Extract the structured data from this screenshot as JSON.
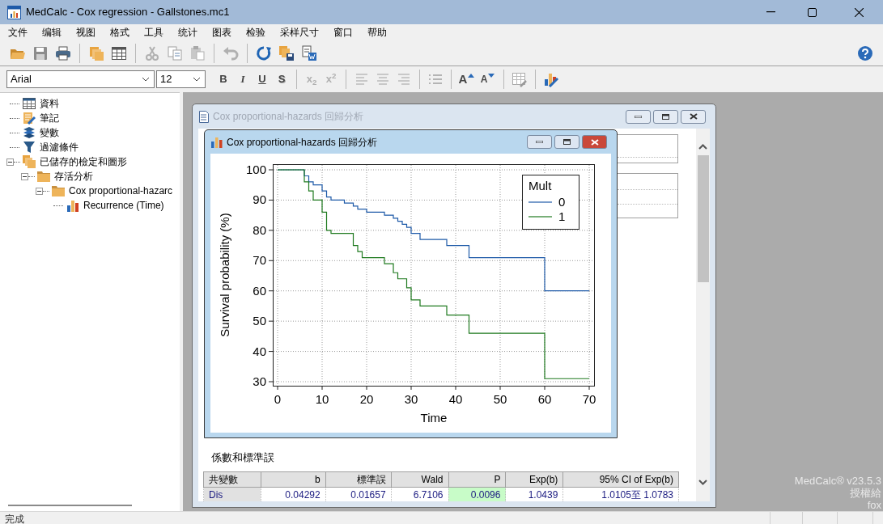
{
  "window": {
    "title": "MedCalc - Cox regression - Gallstones.mc1"
  },
  "menu": [
    "文件",
    "编辑",
    "视图",
    "格式",
    "工具",
    "统计",
    "图表",
    "检验",
    "采样尺寸",
    "窗口",
    "帮助"
  ],
  "format_bar": {
    "font": "Arial",
    "size": "12",
    "buttons": [
      {
        "label": "B",
        "kind": "bold"
      },
      {
        "label": "I",
        "kind": "italic"
      },
      {
        "label": "U",
        "kind": "underline"
      },
      {
        "label": "S",
        "kind": "shadow"
      },
      {
        "label": "x$_{2}$",
        "kind": "script"
      },
      {
        "label": "x$^{2}$",
        "kind": "script"
      }
    ],
    "size_buttons": [
      {
        "label": "A",
        "kind": "grow"
      },
      {
        "label": "A",
        "kind": "shrink"
      }
    ]
  },
  "tree": [
    {
      "label": "資料",
      "kind": "data"
    },
    {
      "label": "筆記",
      "kind": "notes"
    },
    {
      "label": "變數",
      "kind": "variables"
    },
    {
      "label": "過濾條件",
      "kind": "filter"
    },
    {
      "label": "已儲存的檢定和圖形",
      "kind": "saved",
      "expanded": true,
      "children": [
        {
          "label": "存活分析",
          "kind": "folder",
          "expanded": true,
          "children": [
            {
              "label": "Cox proportional-hazarc",
              "kind": "folder",
              "expanded": true,
              "children": [
                {
                  "label": "Recurrence (Time)",
                  "kind": "chart"
                }
              ]
            }
          ]
        }
      ]
    }
  ],
  "report_window": {
    "title": "Cox proportional-hazards 回歸分析",
    "active": false,
    "section_title": "係數和標準誤",
    "table": {
      "columns": [
        "共變數",
        "b",
        "標準誤",
        "Wald",
        "P",
        "Exp(b)",
        "95% CI of Exp(b)"
      ],
      "rows": [
        {
          "cells": [
            {
              "text": "Dis",
              "highlighted": false
            },
            {
              "text": "0.04292",
              "highlighted": false
            },
            {
              "text": "0.01657",
              "highlighted": false
            },
            {
              "text": "6.7106",
              "highlighted": false
            },
            {
              "text": "0.0096",
              "highlighted": true
            },
            {
              "text": "1.0439",
              "highlighted": false
            },
            {
              "text": "1.0105至 1.0783",
              "highlighted": false
            }
          ]
        }
      ]
    }
  },
  "graph_window": {
    "title": "Cox proportional-hazards 回歸分析",
    "active": true,
    "chart_data": {
      "type": "line",
      "xlabel": "Time",
      "ylabel": "Survival probability (%)",
      "grid": true,
      "legend": {
        "title": "Mult"
      },
      "x": [
        0,
        6,
        6,
        7,
        7,
        8,
        8,
        10,
        10,
        11,
        11,
        12,
        12,
        15,
        15,
        17,
        17,
        18,
        18,
        19,
        19,
        20,
        20,
        24,
        24,
        26,
        26,
        27,
        27,
        28,
        28,
        29,
        29,
        30,
        30,
        32,
        32,
        38,
        38,
        43,
        43,
        60,
        60,
        70
      ],
      "series": [
        {
          "name": "0",
          "color": "#1e5aa8",
          "values": [
            100,
            100,
            98,
            98,
            96,
            96,
            95,
            95,
            93,
            93,
            91,
            91,
            90,
            90,
            89,
            89,
            88,
            88,
            87,
            87,
            87,
            87,
            86,
            86,
            85,
            85,
            84,
            84,
            83,
            83,
            82,
            82,
            81,
            81,
            79,
            79,
            77,
            77,
            75,
            75,
            71,
            71,
            60,
            60
          ]
        },
        {
          "name": "1",
          "color": "#1f7a1f",
          "values": [
            100,
            100,
            96,
            96,
            93,
            93,
            90,
            90,
            86,
            86,
            80,
            80,
            79,
            79,
            79,
            79,
            75,
            75,
            73,
            73,
            71,
            71,
            71,
            71,
            69,
            69,
            66,
            66,
            64,
            64,
            64,
            64,
            61,
            61,
            57,
            57,
            55,
            55,
            52,
            52,
            46,
            46,
            31,
            31
          ]
        }
      ],
      "xlim": [
        0,
        70
      ],
      "ylim": [
        30,
        100
      ],
      "xticks": [
        0,
        10,
        20,
        30,
        40,
        50,
        60,
        70
      ],
      "yticks": [
        30,
        40,
        50,
        60,
        70,
        80,
        90,
        100
      ]
    }
  },
  "license": [
    "MedCalc® v23.5.3",
    "授權給",
    "fox"
  ],
  "status_bar": "完成"
}
